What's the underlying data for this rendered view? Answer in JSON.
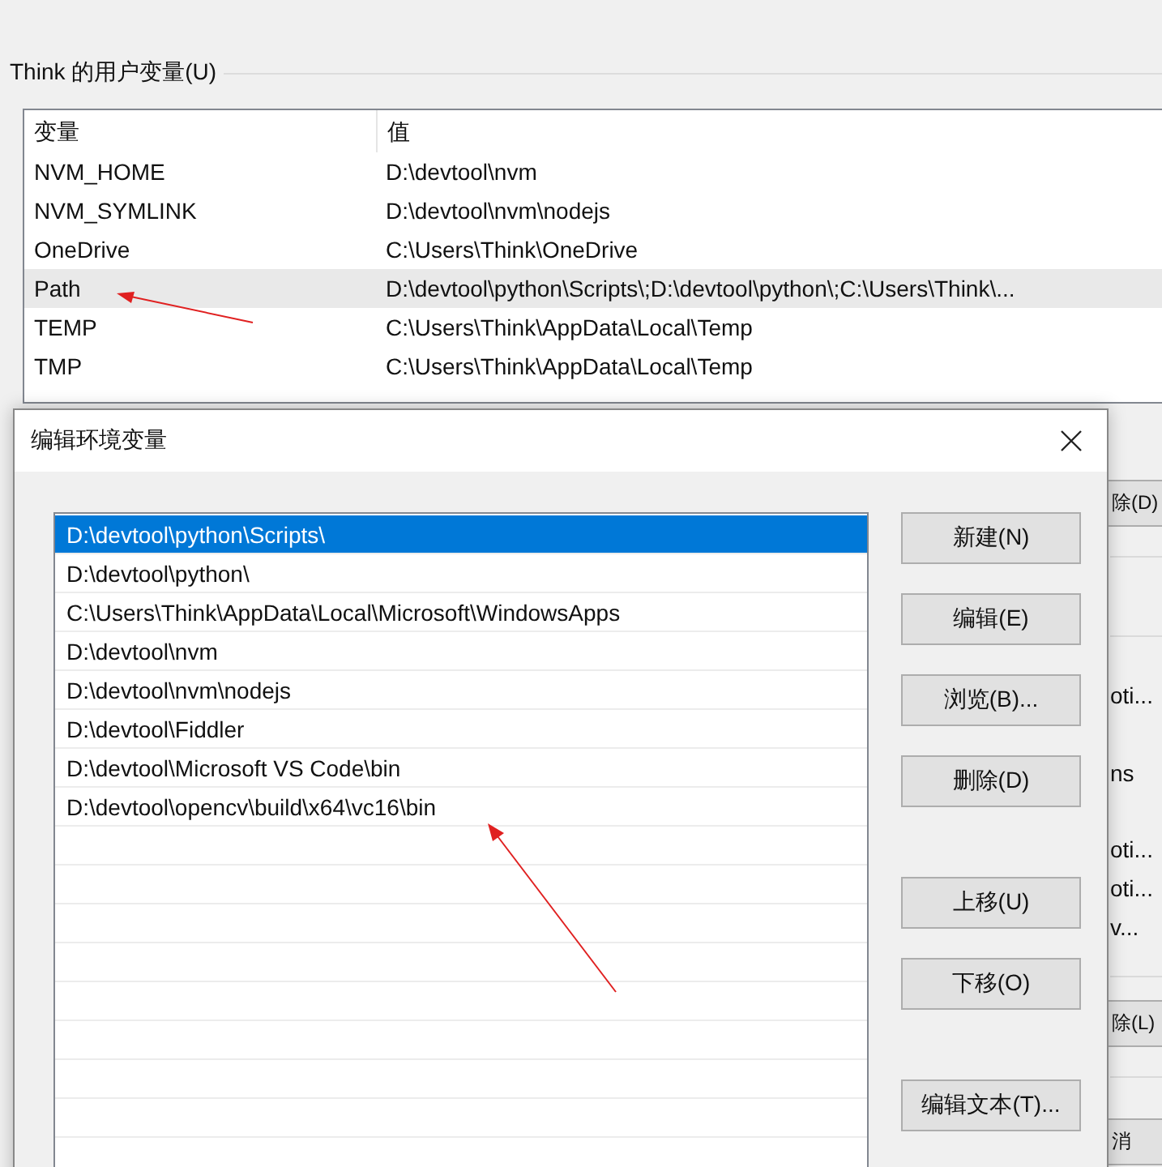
{
  "group": {
    "label": "Think 的用户变量(U)"
  },
  "user_vars": {
    "columns": [
      "变量",
      "值"
    ],
    "rows": [
      {
        "name": "NVM_HOME",
        "value": "D:\\devtool\\nvm",
        "selected": false
      },
      {
        "name": "NVM_SYMLINK",
        "value": "D:\\devtool\\nvm\\nodejs",
        "selected": false
      },
      {
        "name": "OneDrive",
        "value": "C:\\Users\\Think\\OneDrive",
        "selected": false
      },
      {
        "name": "Path",
        "value": "D:\\devtool\\python\\Scripts\\;D:\\devtool\\python\\;C:\\Users\\Think\\...",
        "selected": true
      },
      {
        "name": "TEMP",
        "value": "C:\\Users\\Think\\AppData\\Local\\Temp",
        "selected": false
      },
      {
        "name": "TMP",
        "value": "C:\\Users\\Think\\AppData\\Local\\Temp",
        "selected": false
      }
    ]
  },
  "behind": [
    {
      "kind": "button",
      "text": "除(D)"
    },
    {
      "kind": "text",
      "text": "oti..."
    },
    {
      "kind": "text",
      "text": "ns"
    },
    {
      "kind": "text",
      "text": "oti..."
    },
    {
      "kind": "text",
      "text": "oti..."
    },
    {
      "kind": "text",
      "text": "v..."
    },
    {
      "kind": "button",
      "text": "除(L)"
    },
    {
      "kind": "button",
      "text": "消"
    }
  ],
  "dialog": {
    "title": "编辑环境变量",
    "entries": [
      {
        "text": "D:\\devtool\\python\\Scripts\\",
        "selected": true
      },
      {
        "text": "D:\\devtool\\python\\",
        "selected": false
      },
      {
        "text": "C:\\Users\\Think\\AppData\\Local\\Microsoft\\WindowsApps",
        "selected": false
      },
      {
        "text": "D:\\devtool\\nvm",
        "selected": false
      },
      {
        "text": "D:\\devtool\\nvm\\nodejs",
        "selected": false
      },
      {
        "text": "D:\\devtool\\Fiddler",
        "selected": false
      },
      {
        "text": "D:\\devtool\\Microsoft VS Code\\bin",
        "selected": false
      },
      {
        "text": "D:\\devtool\\opencv\\build\\x64\\vc16\\bin",
        "selected": false
      }
    ],
    "button_groups": [
      [
        "新建(N)",
        "编辑(E)",
        "浏览(B)...",
        "删除(D)"
      ],
      [
        "上移(U)",
        "下移(O)"
      ],
      [
        "编辑文本(T)..."
      ]
    ]
  }
}
